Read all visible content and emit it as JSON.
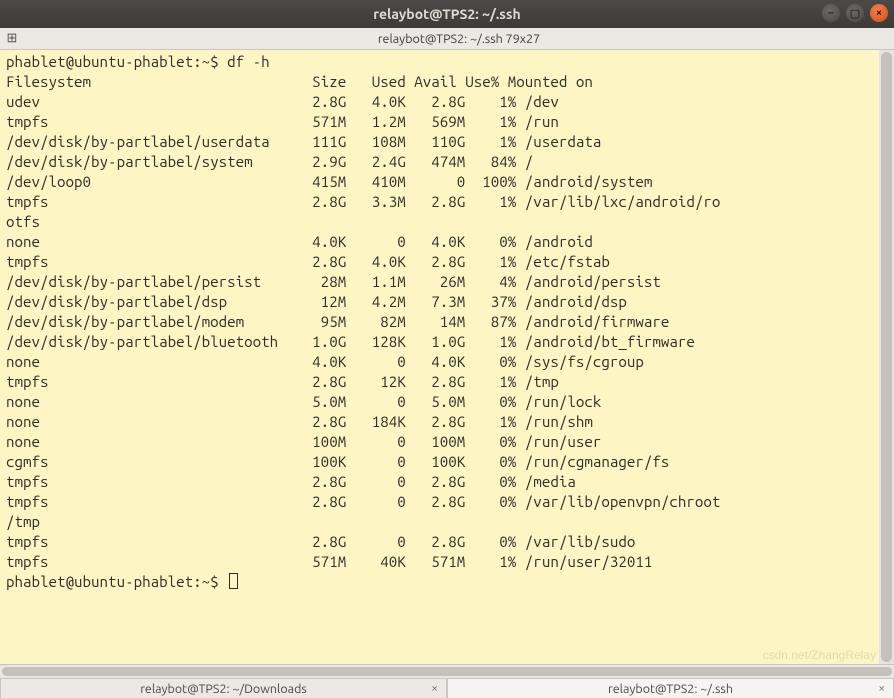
{
  "titlebar": {
    "title": "relaybot@TPS2: ~/.ssh"
  },
  "infobar": {
    "center": "relaybot@TPS2: ~/.ssh 79x27"
  },
  "prompt1": {
    "userhost": "phablet@ubuntu-phablet:~$ ",
    "cmd": "df -h"
  },
  "header": {
    "c0": "Filesystem",
    "c1": "Size",
    "c2": "Used",
    "c3": "Avail",
    "c4": "Use%",
    "c5": "Mounted on"
  },
  "rows": [
    {
      "fs": "udev",
      "size": "2.8G",
      "used": "4.0K",
      "avail": "2.8G",
      "pct": "1%",
      "mnt": "/dev"
    },
    {
      "fs": "tmpfs",
      "size": "571M",
      "used": "1.2M",
      "avail": "569M",
      "pct": "1%",
      "mnt": "/run"
    },
    {
      "fs": "/dev/disk/by-partlabel/userdata",
      "size": "111G",
      "used": "108M",
      "avail": "110G",
      "pct": "1%",
      "mnt": "/userdata"
    },
    {
      "fs": "/dev/disk/by-partlabel/system",
      "size": "2.9G",
      "used": "2.4G",
      "avail": "474M",
      "pct": "84%",
      "mnt": "/"
    },
    {
      "fs": "/dev/loop0",
      "size": "415M",
      "used": "410M",
      "avail": "0",
      "pct": "100%",
      "mnt": "/android/system"
    },
    {
      "fs": "tmpfs",
      "size": "2.8G",
      "used": "3.3M",
      "avail": "2.8G",
      "pct": "1%",
      "mnt": "/var/lib/lxc/android/ro",
      "wrap": "otfs"
    },
    {
      "fs": "none",
      "size": "4.0K",
      "used": "0",
      "avail": "4.0K",
      "pct": "0%",
      "mnt": "/android"
    },
    {
      "fs": "tmpfs",
      "size": "2.8G",
      "used": "4.0K",
      "avail": "2.8G",
      "pct": "1%",
      "mnt": "/etc/fstab"
    },
    {
      "fs": "/dev/disk/by-partlabel/persist",
      "size": "28M",
      "used": "1.1M",
      "avail": "26M",
      "pct": "4%",
      "mnt": "/android/persist"
    },
    {
      "fs": "/dev/disk/by-partlabel/dsp",
      "size": "12M",
      "used": "4.2M",
      "avail": "7.3M",
      "pct": "37%",
      "mnt": "/android/dsp"
    },
    {
      "fs": "/dev/disk/by-partlabel/modem",
      "size": "95M",
      "used": "82M",
      "avail": "14M",
      "pct": "87%",
      "mnt": "/android/firmware"
    },
    {
      "fs": "/dev/disk/by-partlabel/bluetooth",
      "size": "1.0G",
      "used": "128K",
      "avail": "1.0G",
      "pct": "1%",
      "mnt": "/android/bt_firmware"
    },
    {
      "fs": "none",
      "size": "4.0K",
      "used": "0",
      "avail": "4.0K",
      "pct": "0%",
      "mnt": "/sys/fs/cgroup"
    },
    {
      "fs": "tmpfs",
      "size": "2.8G",
      "used": "12K",
      "avail": "2.8G",
      "pct": "1%",
      "mnt": "/tmp"
    },
    {
      "fs": "none",
      "size": "5.0M",
      "used": "0",
      "avail": "5.0M",
      "pct": "0%",
      "mnt": "/run/lock"
    },
    {
      "fs": "none",
      "size": "2.8G",
      "used": "184K",
      "avail": "2.8G",
      "pct": "1%",
      "mnt": "/run/shm"
    },
    {
      "fs": "none",
      "size": "100M",
      "used": "0",
      "avail": "100M",
      "pct": "0%",
      "mnt": "/run/user"
    },
    {
      "fs": "cgmfs",
      "size": "100K",
      "used": "0",
      "avail": "100K",
      "pct": "0%",
      "mnt": "/run/cgmanager/fs"
    },
    {
      "fs": "tmpfs",
      "size": "2.8G",
      "used": "0",
      "avail": "2.8G",
      "pct": "0%",
      "mnt": "/media"
    },
    {
      "fs": "tmpfs",
      "size": "2.8G",
      "used": "0",
      "avail": "2.8G",
      "pct": "0%",
      "mnt": "/var/lib/openvpn/chroot",
      "wrap": "/tmp"
    },
    {
      "fs": "tmpfs",
      "size": "2.8G",
      "used": "0",
      "avail": "2.8G",
      "pct": "0%",
      "mnt": "/var/lib/sudo"
    },
    {
      "fs": "tmpfs",
      "size": "571M",
      "used": "40K",
      "avail": "571M",
      "pct": "1%",
      "mnt": "/run/user/32011"
    }
  ],
  "prompt2": {
    "userhost": "phablet@ubuntu-phablet:~$ "
  },
  "watermark": "csdn.net/ZhangRelay",
  "tabs": [
    {
      "label": "relaybot@TPS2: ~/Downloads",
      "active": false
    },
    {
      "label": "relaybot@TPS2: ~/.ssh",
      "active": true
    }
  ],
  "cols": {
    "fs": 34,
    "size": 6,
    "used": 6,
    "avail": 6,
    "pct": 5
  }
}
